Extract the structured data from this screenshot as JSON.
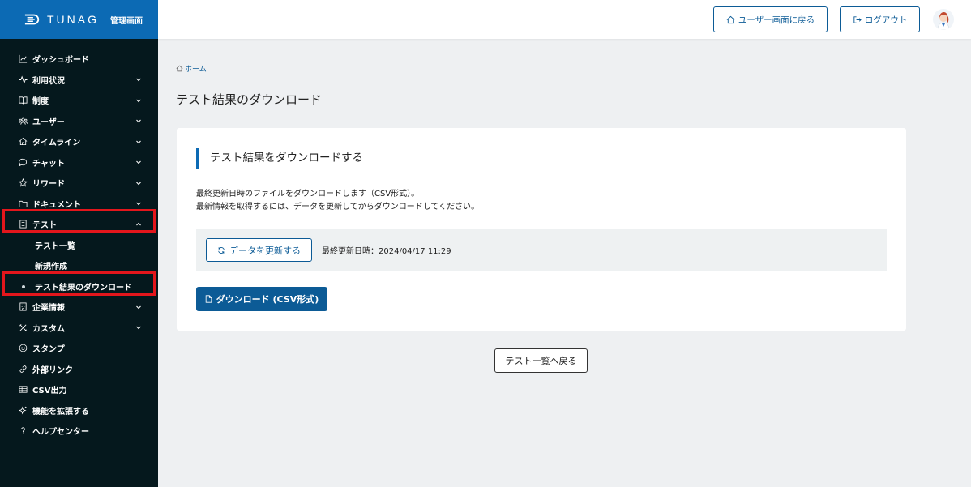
{
  "brand": {
    "name": "TUNAG",
    "subtitle": "管理画面"
  },
  "sidebar": {
    "items": [
      {
        "label": "ダッシュボード",
        "icon": "chart-line-icon",
        "expandable": false
      },
      {
        "label": "利用状況",
        "icon": "activity-icon",
        "expandable": true
      },
      {
        "label": "制度",
        "icon": "book-icon",
        "expandable": true
      },
      {
        "label": "ユーザー",
        "icon": "users-icon",
        "expandable": true
      },
      {
        "label": "タイムライン",
        "icon": "home-icon",
        "expandable": true
      },
      {
        "label": "チャット",
        "icon": "chat-icon",
        "expandable": true
      },
      {
        "label": "リワード",
        "icon": "star-icon",
        "expandable": true
      },
      {
        "label": "ドキュメント",
        "icon": "folder-icon",
        "expandable": true
      },
      {
        "label": "テスト",
        "icon": "document-list-icon",
        "expandable": true,
        "expanded": true
      },
      {
        "label": "企業情報",
        "icon": "building-icon",
        "expandable": true
      },
      {
        "label": "カスタム",
        "icon": "tools-icon",
        "expandable": true
      },
      {
        "label": "スタンプ",
        "icon": "smile-icon",
        "expandable": false
      },
      {
        "label": "外部リンク",
        "icon": "link-icon",
        "expandable": false
      },
      {
        "label": "CSV出力",
        "icon": "table-icon",
        "expandable": false
      },
      {
        "label": "機能を拡張する",
        "icon": "sparkle-icon",
        "expandable": false
      },
      {
        "label": "ヘルプセンター",
        "icon": "help-icon",
        "expandable": false
      }
    ],
    "test_subitems": [
      {
        "label": "テスト一覧"
      },
      {
        "label": "新規作成"
      },
      {
        "label": "テスト結果のダウンロード",
        "active": true
      }
    ]
  },
  "topbar": {
    "user_screen_label": "ユーザー画面に戻る",
    "logout_label": "ログアウト"
  },
  "breadcrumb": {
    "home": "ホーム"
  },
  "page": {
    "title": "テスト結果のダウンロード",
    "card_title": "テスト結果をダウンロードする",
    "desc_line1": "最終更新日時のファイルをダウンロードします（CSV形式）。",
    "desc_line2": "最新情報を取得するには、データを更新してからダウンロードしてください。",
    "refresh_label": "データを更新する",
    "last_updated": "最終更新日時：2024/04/17 11:29",
    "download_label": "ダウンロード (CSV形式)",
    "back_label": "テスト一覧へ戻る"
  },
  "colors": {
    "brand": "#0c6ab4",
    "sidebar_bg": "#05181d",
    "primary": "#0c5b96",
    "highlight": "#e3161c"
  }
}
